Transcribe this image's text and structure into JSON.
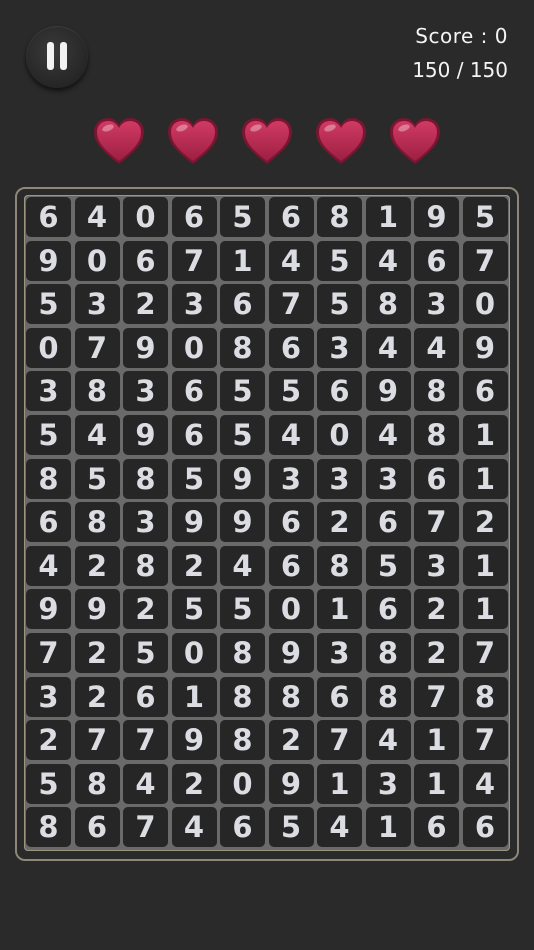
{
  "hud": {
    "score_text": "Score : 0",
    "moves_text": "150 / 150",
    "lives": 5,
    "heart_color": "#b8294f"
  },
  "grid": [
    [
      6,
      4,
      0,
      6,
      5,
      6,
      8,
      1,
      9,
      5
    ],
    [
      9,
      0,
      6,
      7,
      1,
      4,
      5,
      4,
      6,
      7
    ],
    [
      5,
      3,
      2,
      3,
      6,
      7,
      5,
      8,
      3,
      0
    ],
    [
      0,
      7,
      9,
      0,
      8,
      6,
      3,
      4,
      4,
      9
    ],
    [
      3,
      8,
      3,
      6,
      5,
      5,
      6,
      9,
      8,
      6
    ],
    [
      5,
      4,
      9,
      6,
      5,
      4,
      0,
      4,
      8,
      1
    ],
    [
      8,
      5,
      8,
      5,
      9,
      3,
      3,
      3,
      6,
      1
    ],
    [
      6,
      8,
      3,
      9,
      9,
      6,
      2,
      6,
      7,
      2
    ],
    [
      4,
      2,
      8,
      2,
      4,
      6,
      8,
      5,
      3,
      1
    ],
    [
      9,
      9,
      2,
      5,
      5,
      0,
      1,
      6,
      2,
      1
    ],
    [
      7,
      2,
      5,
      0,
      8,
      9,
      3,
      8,
      2,
      7
    ],
    [
      3,
      2,
      6,
      1,
      8,
      8,
      6,
      8,
      7,
      8
    ],
    [
      2,
      7,
      7,
      9,
      8,
      2,
      7,
      4,
      1,
      7
    ],
    [
      5,
      8,
      4,
      2,
      0,
      9,
      1,
      3,
      1,
      4
    ],
    [
      8,
      6,
      7,
      4,
      6,
      5,
      4,
      1,
      6,
      6
    ]
  ]
}
